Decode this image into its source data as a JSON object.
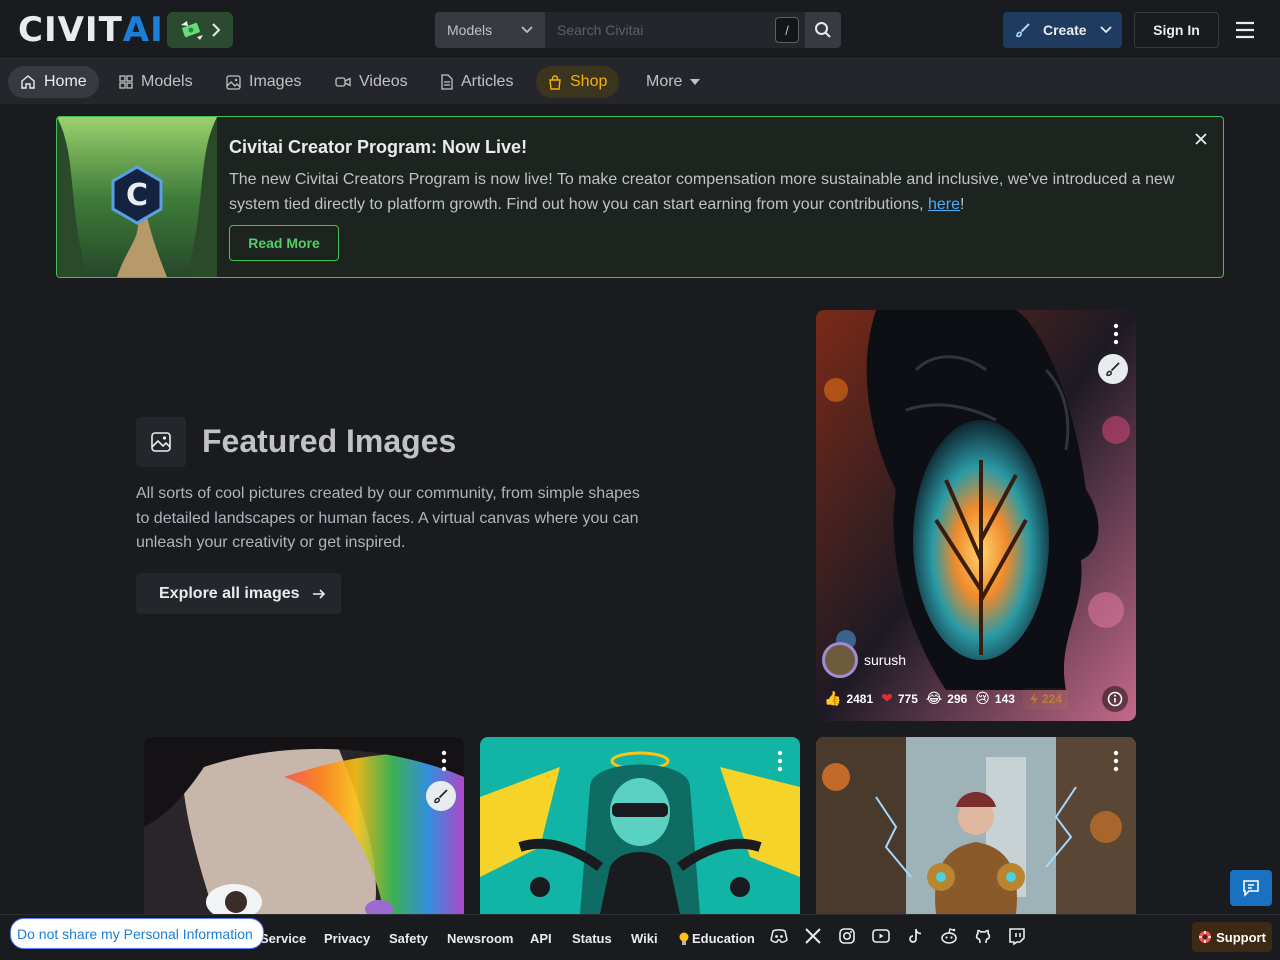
{
  "header": {
    "logo_main": "CIVIT",
    "logo_accent": "AI",
    "search_type": "Models",
    "search_placeholder": "Search Civitai",
    "search_shortcut": "/",
    "create_label": "Create",
    "signin_label": "Sign In"
  },
  "nav": {
    "items": [
      {
        "label": "Home",
        "icon": "home-icon"
      },
      {
        "label": "Models",
        "icon": "grid-icon"
      },
      {
        "label": "Images",
        "icon": "photo-icon"
      },
      {
        "label": "Videos",
        "icon": "video-icon"
      },
      {
        "label": "Articles",
        "icon": "article-icon"
      },
      {
        "label": "Shop",
        "icon": "shopping-bag-icon"
      },
      {
        "label": "More",
        "icon": "caret-down-icon"
      }
    ]
  },
  "banner": {
    "title": "Civitai Creator Program: Now Live!",
    "text_before": "The new Civitai Creators Program is now live! To make creator compensation more sustainable and inclusive, we've introduced a new system tied directly to platform growth. Find out how you can start earning from your contributions, ",
    "link_text": "here",
    "text_after": "!",
    "button_label": "Read More"
  },
  "featured": {
    "title": "Featured Images",
    "description": "All sorts of cool pictures created by our community, from simple shapes to detailed landscapes or human faces. A virtual canvas where you can unleash your creativity or get inspired.",
    "explore_label": "Explore all images"
  },
  "main_card": {
    "author": "surush",
    "reactions": [
      {
        "emoji": "👍",
        "count": "2481"
      },
      {
        "emoji": "❤",
        "count": "775"
      },
      {
        "emoji": "😂",
        "count": "296"
      },
      {
        "emoji": "😢",
        "count": "143"
      }
    ],
    "tip_count": "224"
  },
  "footer": {
    "links": [
      "Service",
      "Privacy",
      "Safety",
      "Newsroom",
      "API",
      "Status",
      "Wiki",
      "Education"
    ],
    "dnsmpi": "Do not share my Personal Information",
    "support_label": "Support",
    "social_icons": [
      "discord-icon",
      "x-icon",
      "instagram-icon",
      "youtube-icon",
      "tiktok-icon",
      "reddit-icon",
      "github-icon",
      "twitch-icon"
    ]
  },
  "colors": {
    "background": "#1a1b1e",
    "accent_blue": "#1c7ed6",
    "banner_green": "#40c057",
    "shop_gold": "#fab005"
  }
}
